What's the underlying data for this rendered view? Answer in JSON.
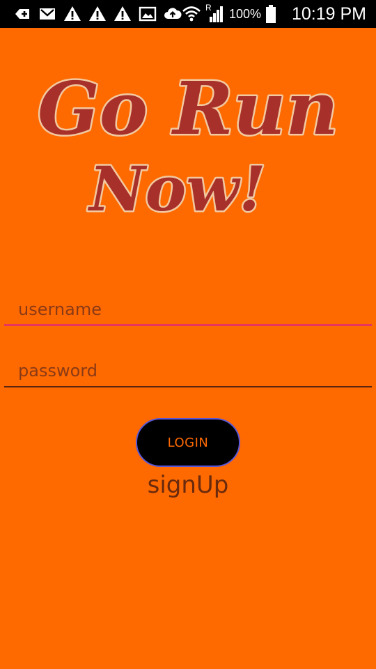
{
  "status_bar": {
    "icons_left": [
      "add-box-icon",
      "gmail-icon",
      "warning-icon",
      "warning-icon",
      "warning-icon",
      "image-icon",
      "cloud-upload-icon"
    ],
    "icons_right": [
      "wifi-icon",
      "signal-roaming-icon",
      "battery-icon"
    ],
    "roaming_label": "R",
    "battery": "100%",
    "time": "10:19 PM"
  },
  "logo": {
    "line1": "Go Run",
    "line2": "Now!"
  },
  "form": {
    "username": {
      "placeholder": "username",
      "value": ""
    },
    "password": {
      "placeholder": "password",
      "value": ""
    },
    "login_label": "LOGIN",
    "signup_label": "signUp"
  },
  "colors": {
    "background": "#ff6a00",
    "logo_fill": "#a8302a",
    "logo_outline": "#f2c9a0",
    "username_underline": "#e6365f",
    "button_bg": "#000000",
    "button_border": "#5856d6",
    "button_text": "#ff6a00"
  }
}
